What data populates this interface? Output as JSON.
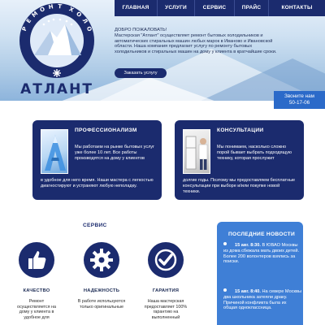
{
  "logo": {
    "brand": "АТЛАНТ",
    "ring_text": "РЕМОНТ ХОЛОДИЛЬНИКОВ В ИВАНОВО И ОБЛАСТИ"
  },
  "nav": {
    "items": [
      {
        "label": "ГЛАВНАЯ"
      },
      {
        "label": "УСЛУГИ"
      },
      {
        "label": "СЕРВИС"
      },
      {
        "label": "ПРАЙС"
      },
      {
        "label": "КОНТАКТЫ"
      }
    ]
  },
  "intro": {
    "title": "ДОБРО ПОЖАЛОВАТЬ!",
    "text": "Мастерская \"Атлант\" осуществляет ремонт бытовых холодильников и автоматических стиральных машин любых марок в Иваново и Ивановской области. Наша компания предлагает услугу по ремонту бытовых холодильников и стиральных машин на дому у клиента в кратчайшие сроки.",
    "button": "Заказать услугу"
  },
  "phone": {
    "label": "Звоните нам",
    "number": "50-17-06"
  },
  "features": [
    {
      "title": "ПРОФЕССИОНАЛИЗМ",
      "text": "Мы работаем на рынке бытовых услуг уже более 10 лет. Все работы производятся на дому у клиентов",
      "text2": "в удобное для него время. Наши мастера с легкостью диагностируют и устраняют любую неполадку."
    },
    {
      "title": "КОНСУЛЬТАЦИИ",
      "text": "Мы понимаем, насколько сложно порой бывает выбрать подходящую технику, которая прослужит",
      "text2": "долгие годы. Поэтому мы предоставляем бесплатные консультации при выборе и/или покупке новой техники."
    }
  ],
  "services": {
    "title": "СЕРВИС",
    "items": [
      {
        "icon": "thumbs-up-icon",
        "title": "КАЧЕСТВО",
        "text": "Ремонт осуществляется на дому у клиента в удобное для"
      },
      {
        "icon": "gear-icon",
        "title": "НАДЕЖНОСТЬ",
        "text": "В работе используются только оригинальные"
      },
      {
        "icon": "checkmark-icon",
        "title": "ГАРАНТИЯ",
        "text": "Наша мастерская предоставляет 100% гарантию на выполненный"
      }
    ]
  },
  "news": {
    "title": "ПОСЛЕДНИЕ НОВОСТИ",
    "items": [
      {
        "date": "15 авг. 8:30.",
        "text": "В ЮВАО Москвы из дома сбежала мать двоих детей. Более 200 волонтеров взялись за поиски."
      },
      {
        "date": "15 авг. 8:40.",
        "text": "На севере Москвы два школьника затеяли драку. Причиной конфликта была их общая одноклассница."
      }
    ]
  },
  "colors": {
    "navy": "#1b2b6e",
    "accent_blue": "#3f7fd6",
    "phone_blue": "#2b6ac9"
  }
}
